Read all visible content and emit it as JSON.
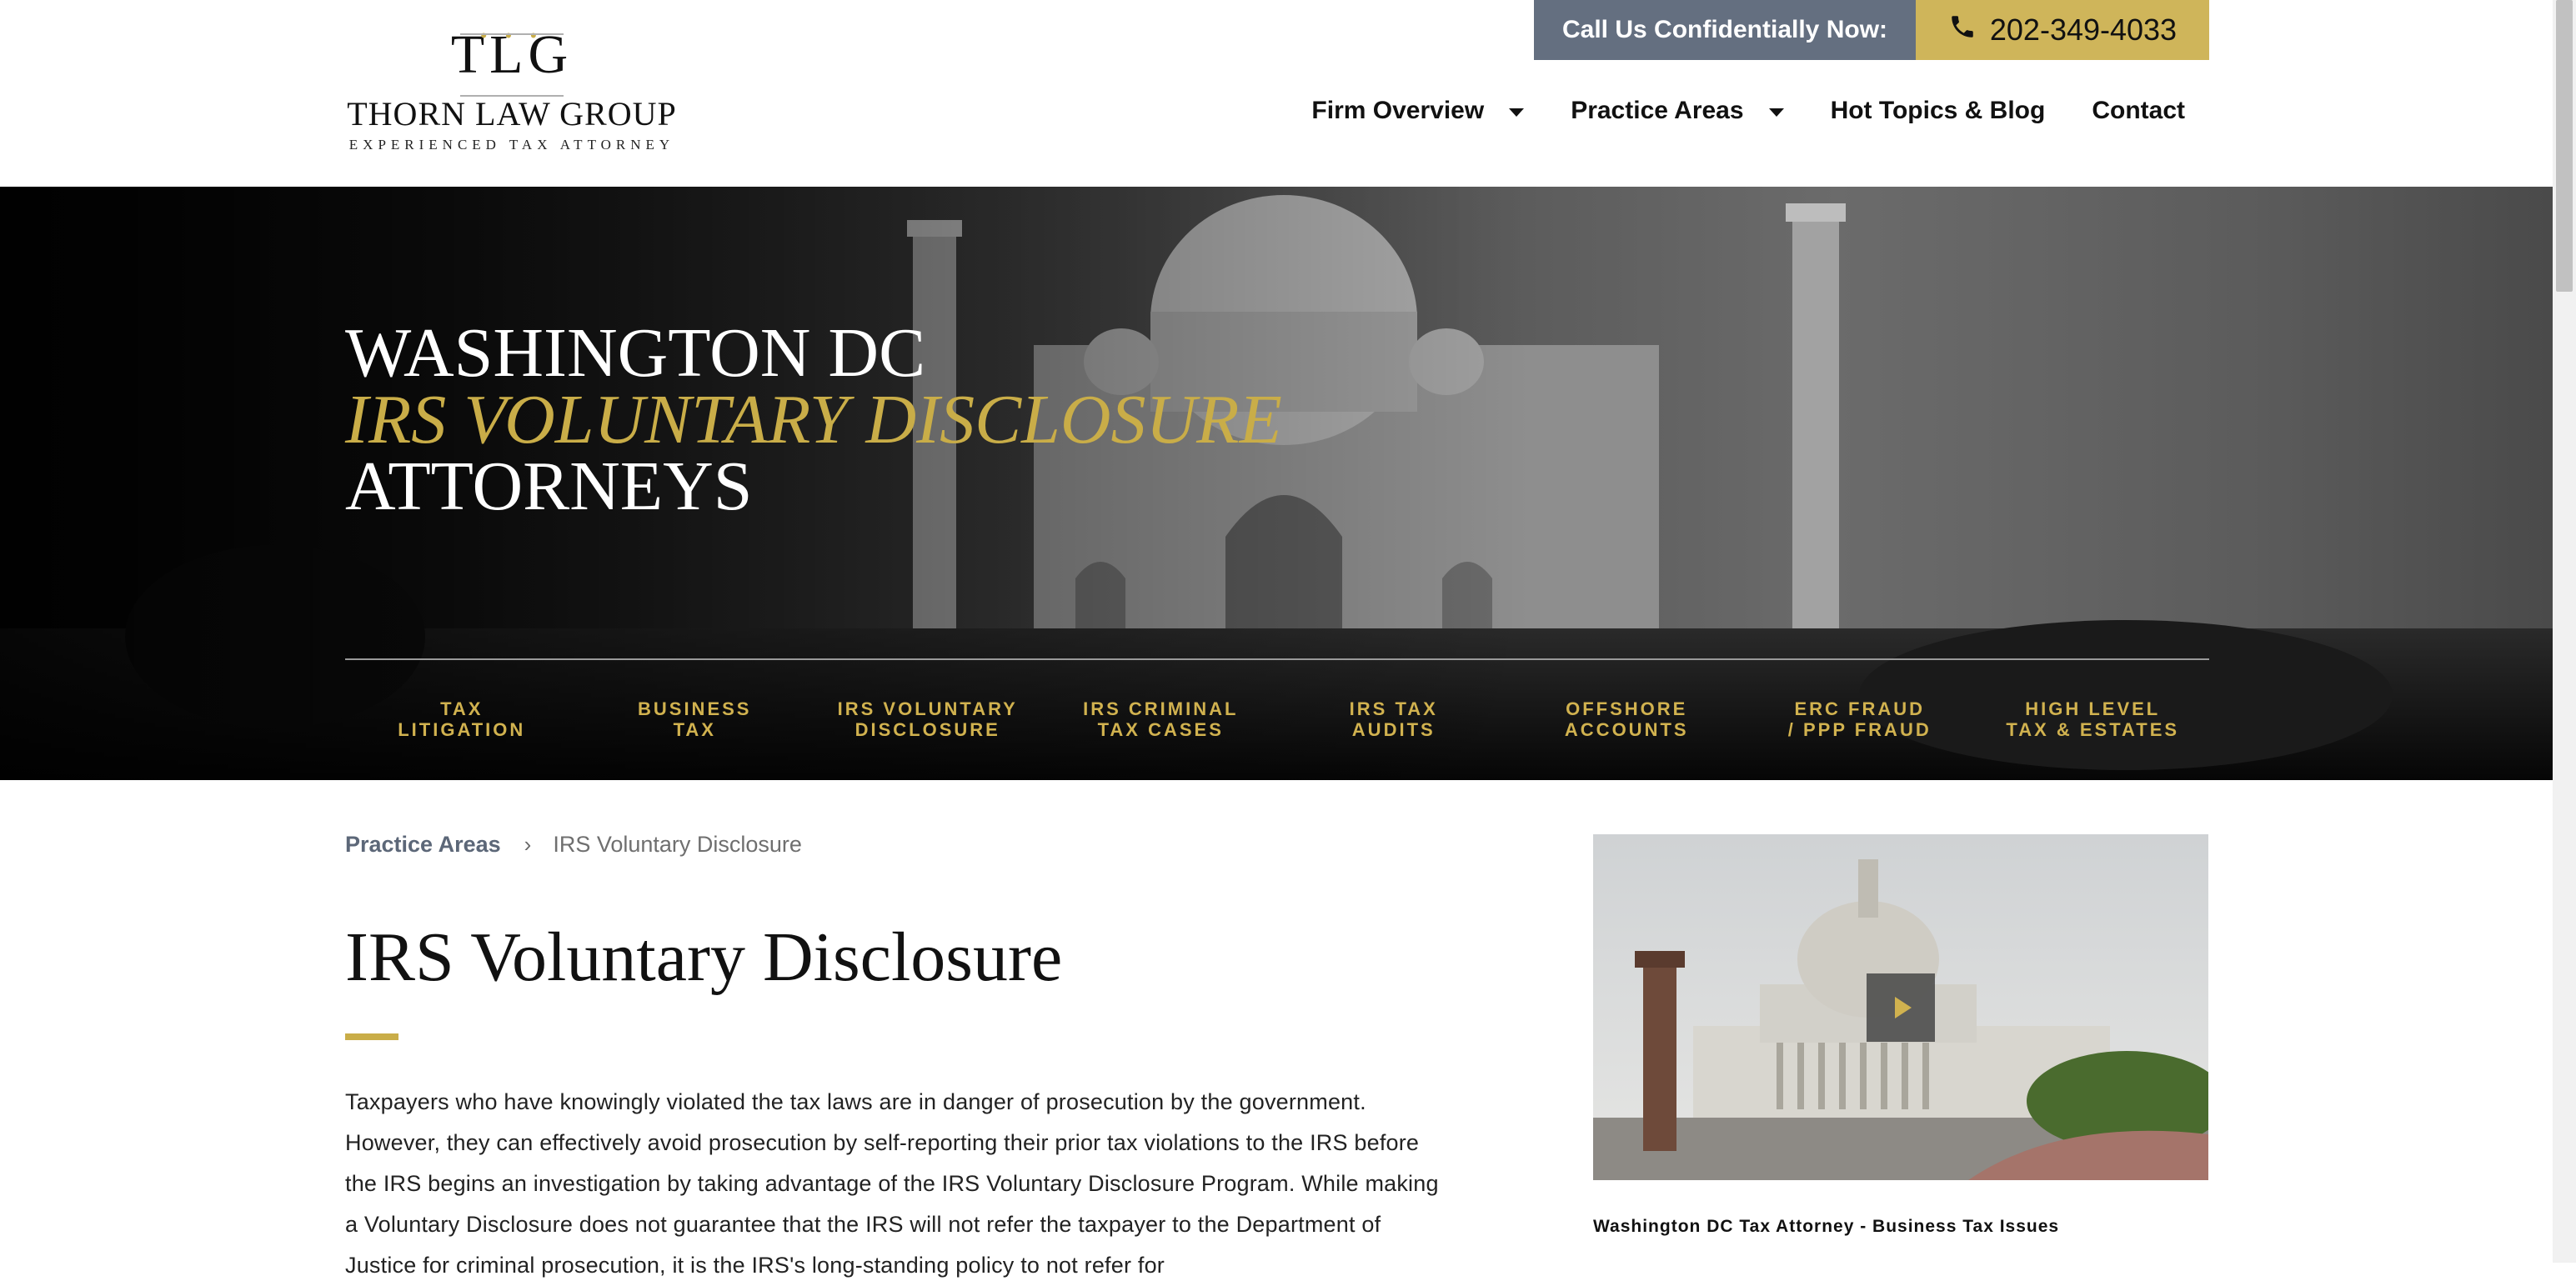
{
  "header": {
    "logo": {
      "mark": "TLG",
      "name": "THORN LAW GROUP",
      "tagline": "EXPERIENCED TAX ATTORNEY"
    },
    "call_label": "Call Us Confidentially Now:",
    "phone": "202-349-4033",
    "phone_icon": "phone-icon",
    "nav": [
      {
        "label": "Firm Overview",
        "has_dropdown": true
      },
      {
        "label": "Practice Areas",
        "has_dropdown": true
      },
      {
        "label": "Hot Topics & Blog",
        "has_dropdown": false
      },
      {
        "label": "Contact",
        "has_dropdown": false
      }
    ]
  },
  "hero": {
    "title_line1": "WASHINGTON DC",
    "title_line2": "IRS VOLUNTARY DISCLOSURE",
    "title_line3": "ATTORNEYS",
    "practice_areas": [
      "TAX\nLITIGATION",
      "BUSINESS\nTAX",
      "IRS VOLUNTARY\nDISCLOSURE",
      "IRS CRIMINAL\nTAX CASES",
      "IRS TAX\nAUDITS",
      "OFFSHORE\nACCOUNTS",
      "ERC FRAUD\n/ PPP FRAUD",
      "HIGH LEVEL\nTAX & ESTATES"
    ]
  },
  "breadcrumb": {
    "parent": "Practice Areas",
    "current": "IRS Voluntary Disclosure"
  },
  "main": {
    "title": "IRS Voluntary Disclosure",
    "paragraph": "Taxpayers who have knowingly violated the tax laws are in danger of prosecution by the government. However, they can effectively avoid prosecution by self-reporting their prior tax violations to the IRS before the IRS begins an investigation by taking advantage of the IRS Voluntary Disclosure Program. While making a Voluntary Disclosure does not guarantee that the IRS will not refer the taxpayer to the Department of Justice for criminal prosecution, it is the IRS's long-standing policy to not refer for"
  },
  "video": {
    "caption": "Washington DC Tax Attorney - Business Tax Issues"
  },
  "colors": {
    "gold": "#c9ad48",
    "slate": "#646f80",
    "phone_bg": "#cfb55a"
  }
}
